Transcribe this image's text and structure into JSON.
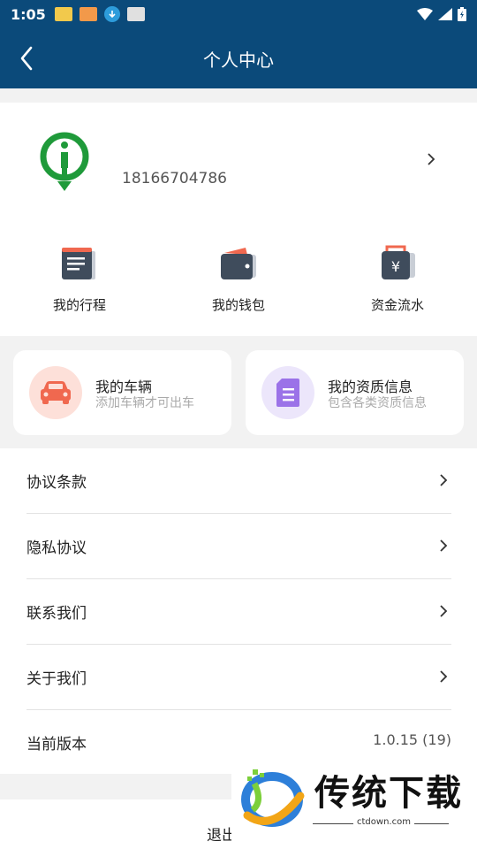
{
  "status_bar": {
    "time": "1:05"
  },
  "nav": {
    "title": "个人中心"
  },
  "profile": {
    "phone": "18166704786"
  },
  "quick_actions": [
    {
      "label": "我的行程",
      "icon": "trip-icon"
    },
    {
      "label": "我的钱包",
      "icon": "wallet-icon"
    },
    {
      "label": "资金流水",
      "icon": "cashflow-icon"
    }
  ],
  "cards": [
    {
      "title": "我的车辆",
      "subtitle": "添加车辆才可出车",
      "icon": "car-icon",
      "color": "#f0684f"
    },
    {
      "title": "我的资质信息",
      "subtitle": "包含各类资质信息",
      "icon": "document-icon",
      "color": "#9b72e8"
    }
  ],
  "list": [
    {
      "label": "协议条款"
    },
    {
      "label": "隐私协议"
    },
    {
      "label": "联系我们"
    },
    {
      "label": "关于我们"
    },
    {
      "label": "当前版本",
      "value": "1.0.15 (19)"
    }
  ],
  "logout": {
    "label": "退出"
  },
  "watermark": {
    "text": "传统下载",
    "url": "ctdown.com"
  },
  "colors": {
    "header": "#0b4a7a",
    "brand_green": "#1f9a3a"
  }
}
